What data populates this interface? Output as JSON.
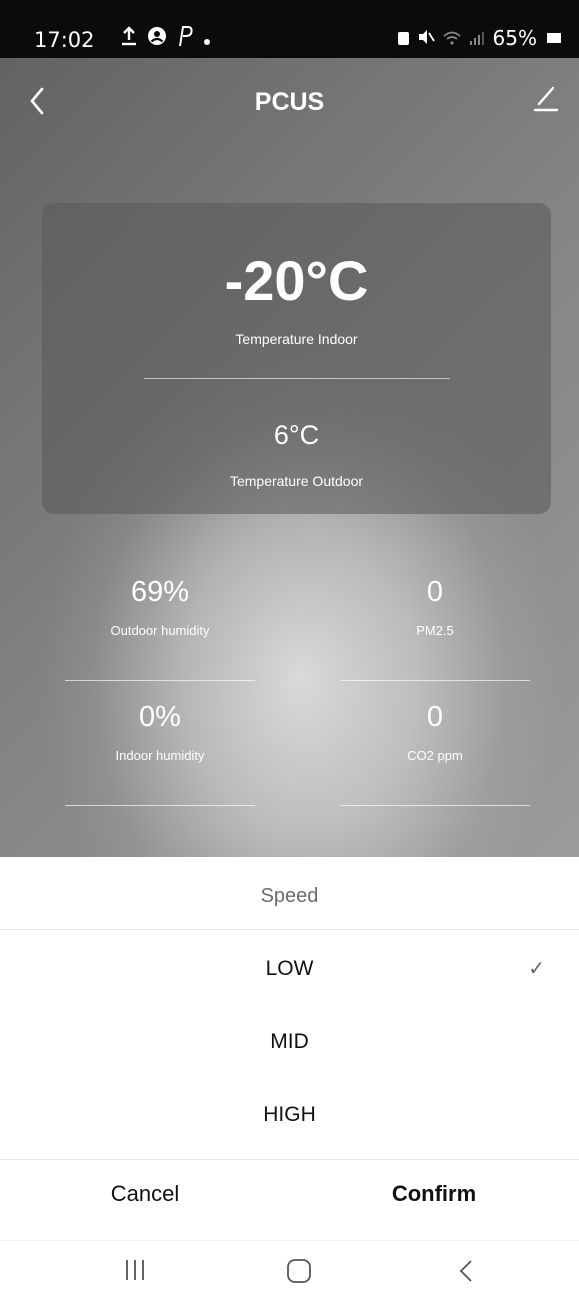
{
  "status_bar": {
    "time": "17:02",
    "icons": [
      "upload-icon",
      "account-circle-icon",
      "p-logo-icon",
      "dot-icon"
    ],
    "right_icons": [
      "lock-icon",
      "mute-icon",
      "wifi-icon",
      "signal-icon"
    ],
    "battery": "65%"
  },
  "header": {
    "title": "PCUS"
  },
  "card": {
    "indoor_value": "-20°C",
    "indoor_label": "Temperature Indoor",
    "outdoor_value": "6°C",
    "outdoor_label": "Temperature Outdoor"
  },
  "stats": {
    "outdoor_humidity": {
      "value": "69%",
      "label": "Outdoor humidity"
    },
    "pm25": {
      "value": "0",
      "label": "PM2.5"
    },
    "indoor_humidity": {
      "value": "0%",
      "label": "Indoor humidity"
    },
    "co2": {
      "value": "0",
      "label": "CO2 ppm"
    }
  },
  "sheet": {
    "title": "Speed",
    "options": [
      {
        "label": "LOW",
        "selected": true
      },
      {
        "label": "MID",
        "selected": false
      },
      {
        "label": "HIGH",
        "selected": false
      }
    ],
    "check_mark": "✓",
    "cancel": "Cancel",
    "confirm": "Confirm"
  },
  "nav": [
    "recent-apps-icon",
    "home-icon",
    "back-icon"
  ],
  "colors": {
    "status_bar": "#0b0b0b",
    "sheet_bg": "#ffffff",
    "text_dark": "#111111",
    "text_muted": "#6b6b6b"
  }
}
